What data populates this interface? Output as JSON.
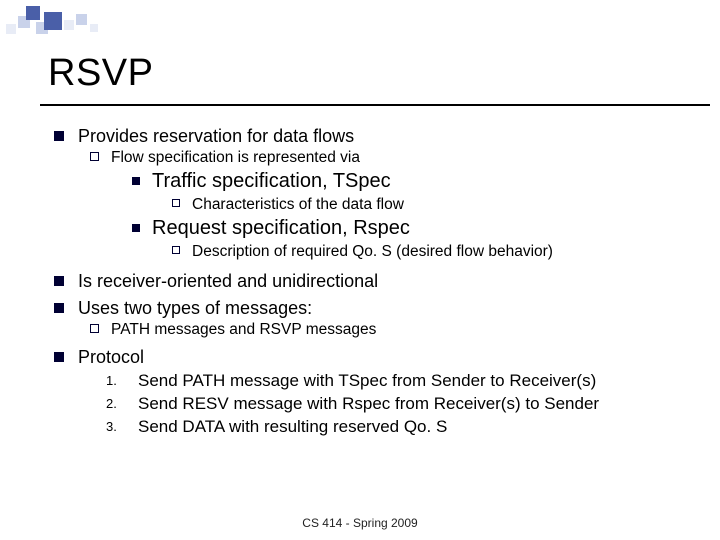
{
  "title": "RSVP",
  "bullets": {
    "b1": "Provides reservation for data flows",
    "b1_1": "Flow specification is represented via",
    "b1_1_a": "Traffic specification, TSpec",
    "b1_1_a_i": "Characteristics of the data flow",
    "b1_1_b": "Request specification, Rspec",
    "b1_1_b_i": "Description of required Qo. S (desired flow behavior)",
    "b2": "Is receiver-oriented and unidirectional",
    "b3": "Uses two types of messages:",
    "b3_1": "PATH messages and RSVP messages",
    "b4": "Protocol",
    "n1_label": "1.",
    "n1": "Send PATH message with TSpec from Sender to Receiver(s)",
    "n2_label": "2.",
    "n2": "Send RESV message with Rspec from Receiver(s) to Sender",
    "n3_label": "3.",
    "n3": "Send DATA with resulting reserved Qo. S"
  },
  "footer": "CS 414 - Spring 2009"
}
